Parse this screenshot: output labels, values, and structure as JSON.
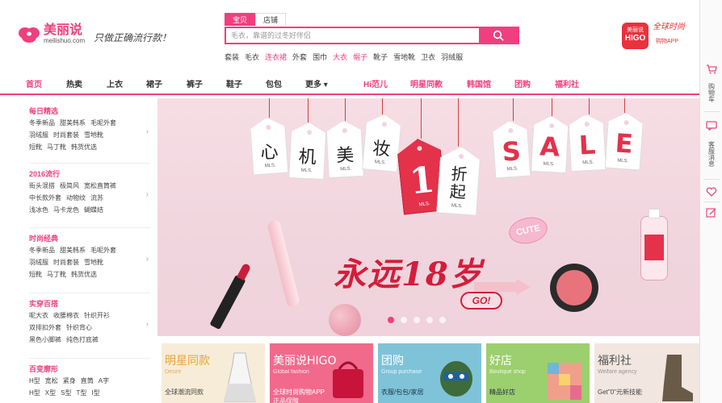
{
  "header": {
    "logo_name": "美丽说",
    "logo_domain": "meilishuo.com",
    "slogan": "只做正确流行款！",
    "search": {
      "tabs": [
        "宝贝",
        "店铺"
      ],
      "active_tab": 0,
      "placeholder": "毛衣，靠谱的过冬好伴侣"
    },
    "hot_words": [
      {
        "text": "套装",
        "hl": false
      },
      {
        "text": "毛衣",
        "hl": false
      },
      {
        "text": "连衣裙",
        "hl": true
      },
      {
        "text": "外套",
        "hl": false
      },
      {
        "text": "围巾",
        "hl": false
      },
      {
        "text": "大衣",
        "hl": true
      },
      {
        "text": "帽子",
        "hl": true
      },
      {
        "text": "靴子",
        "hl": false
      },
      {
        "text": "雪地靴",
        "hl": false
      },
      {
        "text": "卫衣",
        "hl": false
      },
      {
        "text": "羽绒服",
        "hl": false
      }
    ],
    "higo": {
      "badge_top": "美丽说",
      "badge_name": "HIGO",
      "slogan": "全球时尚",
      "sub": "购物APP"
    }
  },
  "nav": {
    "items": [
      {
        "label": "首页",
        "style": "active"
      },
      {
        "label": "热卖",
        "style": "normal"
      },
      {
        "label": "上衣",
        "style": "normal"
      },
      {
        "label": "裙子",
        "style": "normal"
      },
      {
        "label": "裤子",
        "style": "normal"
      },
      {
        "label": "鞋子",
        "style": "normal"
      },
      {
        "label": "包包",
        "style": "normal"
      },
      {
        "label": "更多 ▾",
        "style": "normal"
      },
      {
        "label": "Hi范儿",
        "style": "pink"
      },
      {
        "label": "明星同款",
        "style": "pink"
      },
      {
        "label": "韩国馆",
        "style": "pink"
      },
      {
        "label": "团购",
        "style": "pink"
      },
      {
        "label": "福利社",
        "style": "pink"
      }
    ]
  },
  "categories": [
    {
      "title": "每日精选",
      "rows": [
        [
          "冬季新品",
          "甜美韩系",
          "毛呢外套"
        ],
        [
          "羽绒服",
          "时尚套装",
          "雪地靴"
        ],
        [
          "短靴",
          "马丁靴",
          "韩货优选"
        ]
      ]
    },
    {
      "title": "2016流行",
      "rows": [
        [
          "街头混搭",
          "极简风",
          "宽松直筒裤"
        ],
        [
          "中长款外套",
          "动物纹",
          "流苏"
        ],
        [
          "浅冰色",
          "马卡龙色",
          "蝴蝶结"
        ]
      ]
    },
    {
      "title": "时尚经典",
      "rows": [
        [
          "冬季新品",
          "甜美韩系",
          "毛呢外套"
        ],
        [
          "羽绒服",
          "时尚套装",
          "雪地靴"
        ],
        [
          "短靴",
          "马丁靴",
          "韩货优选"
        ]
      ]
    },
    {
      "title": "实穿百搭",
      "rows": [
        [
          "呢大衣",
          "收腰棉衣",
          "针织开衫"
        ],
        [
          "双排扣外套",
          "针织背心"
        ],
        [
          "黑色小脚裤",
          "纯色打底裤"
        ]
      ]
    },
    {
      "title": "百变廓形",
      "rows": [
        [
          "H型",
          "宽松",
          "紧身",
          "直筒",
          "A字"
        ],
        [
          "H型",
          "X型",
          "S型",
          "T型",
          "I型"
        ]
      ]
    }
  ],
  "banner": {
    "tags_left": [
      "心",
      "机",
      "美",
      "妆"
    ],
    "tag_big_number": "1",
    "tag_fold": "折\n起",
    "tags_sale": [
      "S",
      "A",
      "L",
      "E"
    ],
    "tag_mark": "MLS.",
    "cute": "CUTE",
    "slogan": "永远18岁",
    "go": "GO!",
    "dots": 5,
    "active_dot": 0
  },
  "cards": [
    {
      "title": "明星同款",
      "sub": "Desire",
      "desc": "全球潮流同款",
      "desc2": "",
      "color": "#e9a23b",
      "bg": "#f7ecd8"
    },
    {
      "title": "美丽说HIGO",
      "sub": "Global fashion",
      "desc": "全球时尚购物APP",
      "desc2": "正品保障",
      "color": "#ffffff",
      "bg": "#f16a8c"
    },
    {
      "title": "团购",
      "sub": "Group purchase",
      "desc": "衣服/包包/家居",
      "desc2": "",
      "color": "#ffffff",
      "bg": "#7fc3d9"
    },
    {
      "title": "好店",
      "sub": "Boutique shop",
      "desc": "精品好店",
      "desc2": "",
      "color": "#ffffff",
      "bg": "#9ccf6e"
    },
    {
      "title": "福利社",
      "sub": "Welfare agency",
      "desc": "Get\"0\"元新技能",
      "desc2": "",
      "color": "#555555",
      "bg": "#f2e6e0"
    }
  ],
  "sidebar": {
    "items": [
      "购物车",
      "客服消息"
    ]
  }
}
